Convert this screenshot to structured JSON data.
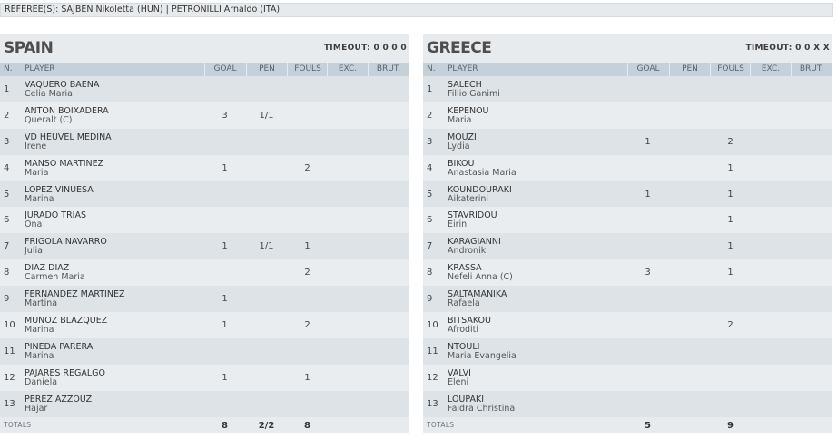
{
  "referee": "REFEREE(S): SAJBEN Nikoletta (HUN) | PETRONILLI Arnaldo (ITA)",
  "columns": {
    "num": "N.",
    "player": "PLAYER",
    "goal": "GOAL",
    "pen": "PEN",
    "fouls": "FOULS",
    "exc": "EXC.",
    "brut": "BRUT."
  },
  "teams": [
    {
      "name": "SPAIN",
      "timeout": "TIMEOUT: 0 0 0 0",
      "players": [
        {
          "num": "1",
          "last": "VAQUERO BAENA",
          "first": "Celia Maria",
          "goal": "",
          "pen": "",
          "fouls": "",
          "exc": "",
          "brut": ""
        },
        {
          "num": "2",
          "last": "ANTON BOIXADERA",
          "first": "Queralt (C)",
          "goal": "3",
          "pen": "1/1",
          "fouls": "",
          "exc": "",
          "brut": ""
        },
        {
          "num": "3",
          "last": "VD HEUVEL MEDINA",
          "first": "Irene",
          "goal": "",
          "pen": "",
          "fouls": "",
          "exc": "",
          "brut": ""
        },
        {
          "num": "4",
          "last": "MANSO MARTINEZ",
          "first": "Maria",
          "goal": "1",
          "pen": "",
          "fouls": "2",
          "exc": "",
          "brut": ""
        },
        {
          "num": "5",
          "last": "LOPEZ VINUESA",
          "first": "Marina",
          "goal": "",
          "pen": "",
          "fouls": "",
          "exc": "",
          "brut": ""
        },
        {
          "num": "6",
          "last": "JURADO TRIAS",
          "first": "Ona",
          "goal": "",
          "pen": "",
          "fouls": "",
          "exc": "",
          "brut": ""
        },
        {
          "num": "7",
          "last": "FRIGOLA NAVARRO",
          "first": "Julia",
          "goal": "1",
          "pen": "1/1",
          "fouls": "1",
          "exc": "",
          "brut": ""
        },
        {
          "num": "8",
          "last": "DIAZ DIAZ",
          "first": "Carmen Maria",
          "goal": "",
          "pen": "",
          "fouls": "2",
          "exc": "",
          "brut": ""
        },
        {
          "num": "9",
          "last": "FERNANDEZ MARTINEZ",
          "first": "Martina",
          "goal": "1",
          "pen": "",
          "fouls": "",
          "exc": "",
          "brut": ""
        },
        {
          "num": "10",
          "last": "MUNOZ BLAZQUEZ",
          "first": "Marina",
          "goal": "1",
          "pen": "",
          "fouls": "2",
          "exc": "",
          "brut": ""
        },
        {
          "num": "11",
          "last": "PINEDA PARERA",
          "first": "Marina",
          "goal": "",
          "pen": "",
          "fouls": "",
          "exc": "",
          "brut": ""
        },
        {
          "num": "12",
          "last": "PAJARES REGALGO",
          "first": "Daniela",
          "goal": "1",
          "pen": "",
          "fouls": "1",
          "exc": "",
          "brut": ""
        },
        {
          "num": "13",
          "last": "PEREZ AZZOUZ",
          "first": "Hajar",
          "goal": "",
          "pen": "",
          "fouls": "",
          "exc": "",
          "brut": ""
        }
      ],
      "totals": {
        "label": "TOTALS",
        "goal": "8",
        "pen": "2/2",
        "fouls": "8"
      }
    },
    {
      "name": "GREECE",
      "timeout": "TIMEOUT: 0 0 X X",
      "players": [
        {
          "num": "1",
          "last": "SALECH",
          "first": "Fillio Ganimi",
          "goal": "",
          "pen": "",
          "fouls": "",
          "exc": "",
          "brut": ""
        },
        {
          "num": "2",
          "last": "KEPENOU",
          "first": "Maria",
          "goal": "",
          "pen": "",
          "fouls": "",
          "exc": "",
          "brut": ""
        },
        {
          "num": "3",
          "last": "MOUZI",
          "first": "Lydia",
          "goal": "1",
          "pen": "",
          "fouls": "2",
          "exc": "",
          "brut": ""
        },
        {
          "num": "4",
          "last": "BIKOU",
          "first": "Anastasia Maria",
          "goal": "",
          "pen": "",
          "fouls": "1",
          "exc": "",
          "brut": ""
        },
        {
          "num": "5",
          "last": "KOUNDOURAKI",
          "first": "Aikaterini",
          "goal": "1",
          "pen": "",
          "fouls": "1",
          "exc": "",
          "brut": ""
        },
        {
          "num": "6",
          "last": "STAVRIDOU",
          "first": "Eirini",
          "goal": "",
          "pen": "",
          "fouls": "1",
          "exc": "",
          "brut": ""
        },
        {
          "num": "7",
          "last": "KARAGIANNI",
          "first": "Androniki",
          "goal": "",
          "pen": "",
          "fouls": "1",
          "exc": "",
          "brut": ""
        },
        {
          "num": "8",
          "last": "KRASSA",
          "first": "Nefeli Anna (C)",
          "goal": "3",
          "pen": "",
          "fouls": "1",
          "exc": "",
          "brut": ""
        },
        {
          "num": "9",
          "last": "SALTAMANIKA",
          "first": "Rafaela",
          "goal": "",
          "pen": "",
          "fouls": "",
          "exc": "",
          "brut": ""
        },
        {
          "num": "10",
          "last": "BITSAKOU",
          "first": "Afroditi",
          "goal": "",
          "pen": "",
          "fouls": "2",
          "exc": "",
          "brut": ""
        },
        {
          "num": "11",
          "last": "NTOULI",
          "first": "Maria Evangelia",
          "goal": "",
          "pen": "",
          "fouls": "",
          "exc": "",
          "brut": ""
        },
        {
          "num": "12",
          "last": "VALVI",
          "first": "Eleni",
          "goal": "",
          "pen": "",
          "fouls": "",
          "exc": "",
          "brut": ""
        },
        {
          "num": "13",
          "last": "LOUPAKI",
          "first": "Faidra Christina",
          "goal": "",
          "pen": "",
          "fouls": "",
          "exc": "",
          "brut": ""
        }
      ],
      "totals": {
        "label": "TOTALS",
        "goal": "5",
        "pen": "",
        "fouls": "9"
      }
    }
  ]
}
